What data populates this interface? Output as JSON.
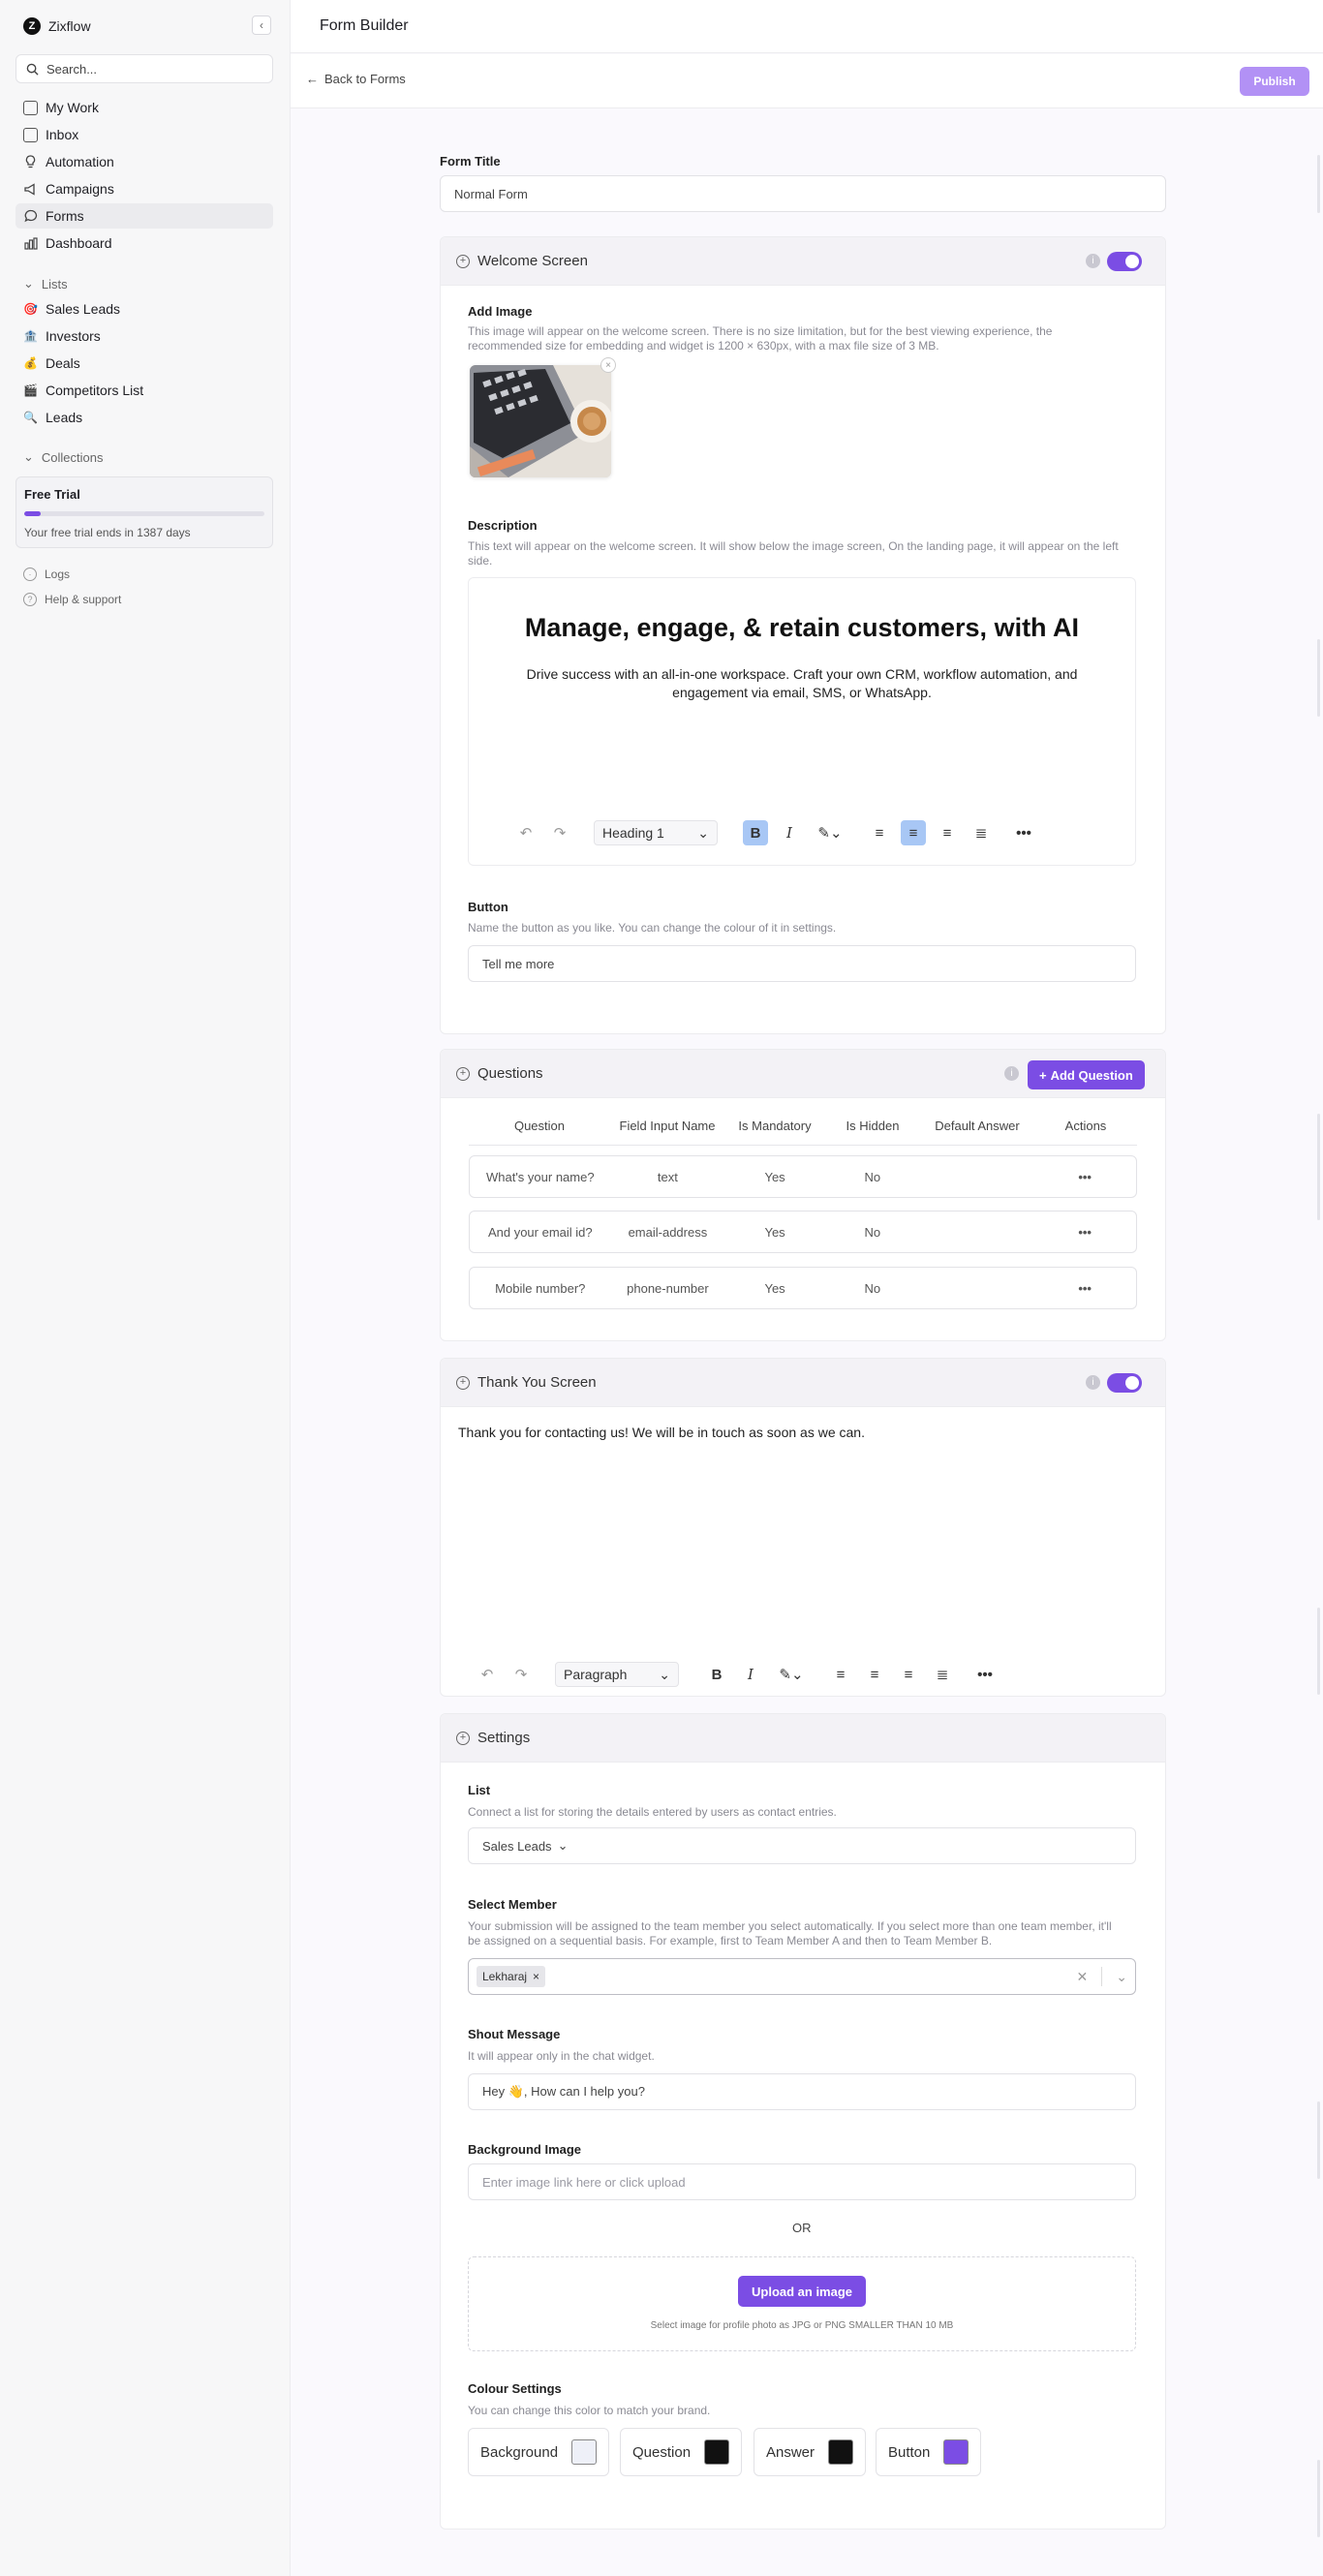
{
  "app": {
    "brand": "Zixflow",
    "brand_initial": "Z",
    "page_title": "Form Builder"
  },
  "sidebar": {
    "search_placeholder": "Search...",
    "nav": [
      {
        "label": "My Work",
        "icon": "checkbox-icon"
      },
      {
        "label": "Inbox",
        "icon": "inbox-icon"
      },
      {
        "label": "Automation",
        "icon": "bulb-icon"
      },
      {
        "label": "Campaigns",
        "icon": "megaphone-icon"
      },
      {
        "label": "Forms",
        "icon": "chat-bubble-icon"
      },
      {
        "label": "Dashboard",
        "icon": "bar-chart-icon"
      }
    ],
    "lists_label": "Lists",
    "lists": [
      {
        "label": "Sales Leads",
        "icon": "🎯"
      },
      {
        "label": "Investors",
        "icon": "🏦"
      },
      {
        "label": "Deals",
        "icon": "💰"
      },
      {
        "label": "Competitors List",
        "icon": "🎬"
      },
      {
        "label": "Leads",
        "icon": "🔍"
      }
    ],
    "collections_label": "Collections",
    "trial": {
      "title": "Free Trial",
      "text": "Your free trial ends in 1387 days",
      "progress": 0.07
    },
    "footer": [
      {
        "label": "Logs"
      },
      {
        "label": "Help & support"
      }
    ]
  },
  "toolbar": {
    "back_label": "Back to Forms",
    "publish_label": "Publish"
  },
  "form": {
    "title_label": "Form Title",
    "title_value": "Normal Form",
    "welcome": {
      "heading": "Welcome Screen",
      "enabled": true,
      "add_image_label": "Add Image",
      "add_image_hint": "This image will appear on the welcome screen. There is no size limitation, but for the best viewing experience, the recommended size for embedding and widget is 1200 × 630px, with a max file size of 3 MB.",
      "description_label": "Description",
      "description_hint": "This text will appear on the welcome screen. It will show below the image screen, On the landing page, it will appear on the left side.",
      "editor_heading": "Manage, engage, & retain customers, with AI",
      "editor_paragraph": "Drive success with an all-in-one workspace. Craft your own CRM, workflow automation, and engagement via email, SMS, or WhatsApp.",
      "editor_block_type": "Heading 1",
      "button_label": "Button",
      "button_hint": "Name the button as you like. You can change the colour of it in settings.",
      "button_value": "Tell me more"
    },
    "questions": {
      "heading": "Questions",
      "add_label": "Add Question",
      "columns": [
        "Question",
        "Field Input Name",
        "Is Mandatory",
        "Is Hidden",
        "Default Answer",
        "Actions"
      ],
      "rows": [
        {
          "question": "What's your name?",
          "field": "text",
          "mandatory": "Yes",
          "hidden": "No",
          "default": ""
        },
        {
          "question": "And your email id?",
          "field": "email-address",
          "mandatory": "Yes",
          "hidden": "No",
          "default": ""
        },
        {
          "question": "Mobile number?",
          "field": "phone-number",
          "mandatory": "Yes",
          "hidden": "No",
          "default": ""
        }
      ]
    },
    "thank_you": {
      "heading": "Thank You Screen",
      "enabled": true,
      "text": "Thank you for contacting us! We will be in touch as soon as we can.",
      "block_type": "Paragraph"
    },
    "settings": {
      "heading": "Settings",
      "list_label": "List",
      "list_hint": "Connect a list for storing the details entered by users as contact entries.",
      "list_value": "Sales Leads",
      "member_label": "Select Member",
      "member_hint": "Your submission will be assigned to the team member you select automatically. If you select more than one team member, it'll be assigned on a sequential basis. For example, first to Team Member A and then to Team Member B.",
      "member_tag": "Lekharaj",
      "shout_label": "Shout Message",
      "shout_hint": "It will appear only in the chat widget.",
      "shout_value": "Hey 👋, How can I help you?",
      "bg_label": "Background Image",
      "bg_placeholder": "Enter image link here or click upload",
      "or_text": "OR",
      "upload_label": "Upload an image",
      "upload_hint": "Select image for profile photo as JPG or PNG SMALLER THAN 10 MB",
      "colour_label": "Colour Settings",
      "colour_hint": "You can change this color to match your brand.",
      "colours": [
        {
          "label": "Background",
          "hex": "#eef0f8"
        },
        {
          "label": "Question",
          "hex": "#111111"
        },
        {
          "label": "Answer",
          "hex": "#111111"
        },
        {
          "label": "Button",
          "hex": "#7b4de4"
        }
      ]
    }
  }
}
